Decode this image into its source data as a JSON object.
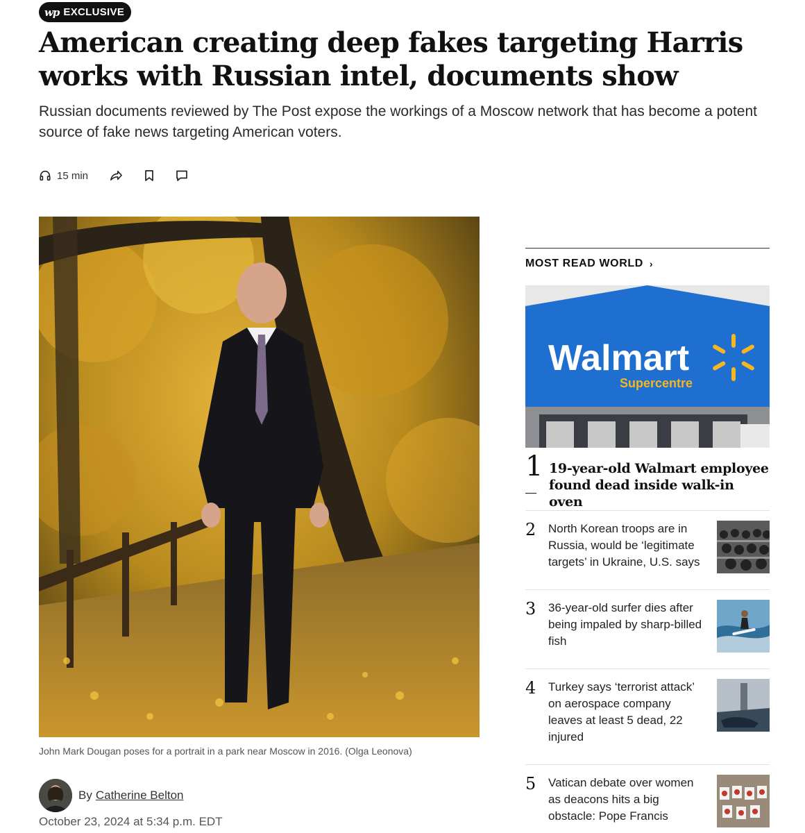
{
  "badge": {
    "logo": "wp",
    "label": "EXCLUSIVE"
  },
  "headline": "American creating deep fakes targeting Harris works with Russian intel, documents show",
  "dek": "Russian documents reviewed by The Post expose the workings of a Moscow network that has become a potent source of fake news targeting American voters.",
  "toolbar": {
    "listen_icon": "headphones-icon",
    "listen_duration": "15 min",
    "share_icon": "share-icon",
    "save_icon": "bookmark-icon",
    "comment_icon": "comment-icon"
  },
  "hero": {
    "caption": "John Mark Dougan poses for a portrait in a park near Moscow in 2016. (Olga Leonova)"
  },
  "byline": {
    "by": "By",
    "author": "Catherine Belton",
    "date": "October 23, 2024 at 5:34 p.m. EDT"
  },
  "rail": {
    "title": "MOST READ WORLD",
    "chevron": "›",
    "feature": {
      "number": "1",
      "title": "19-year-old Walmart employee found dead inside walk-in oven",
      "image": {
        "sign_text": "Walmart",
        "sign_subtext": "Supercentre"
      }
    },
    "items": [
      {
        "number": "2",
        "title": "North Korean troops are in Russia, would be ‘legitimate targets’ in Ukraine, U.S. says"
      },
      {
        "number": "3",
        "title": "36-year-old surfer dies after being impaled by sharp-billed fish"
      },
      {
        "number": "4",
        "title": "Turkey says ‘terrorist attack’ on aerospace company leaves at least 5 dead, 22 injured"
      },
      {
        "number": "5",
        "title": "Vatican debate over women as deacons hits a big obstacle: Pope Francis"
      }
    ]
  },
  "colors": {
    "text": "#111111",
    "walmart_blue": "#1f6fd1",
    "walmart_yellow": "#f5b621",
    "foliage": "#d9a520"
  }
}
